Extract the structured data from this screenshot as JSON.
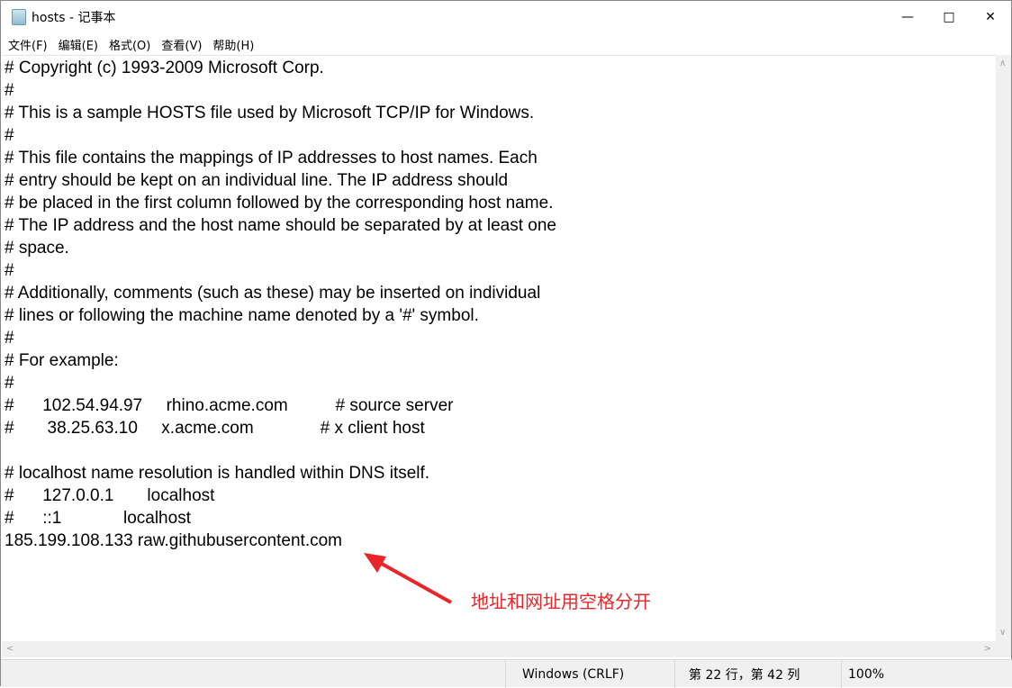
{
  "window": {
    "title": "hosts - 记事本",
    "icon": "notepad-icon",
    "controls": [
      "minimize",
      "maximize",
      "close"
    ]
  },
  "menu": [
    "文件(F)",
    "编辑(E)",
    "格式(O)",
    "查看(V)",
    "帮助(H)"
  ],
  "editor": {
    "text": "# Copyright (c) 1993-2009 Microsoft Corp.\n#\n# This is a sample HOSTS file used by Microsoft TCP/IP for Windows.\n#\n# This file contains the mappings of IP addresses to host names. Each\n# entry should be kept on an individual line. The IP address should\n# be placed in the first column followed by the corresponding host name.\n# The IP address and the host name should be separated by at least one\n# space.\n#\n# Additionally, comments (such as these) may be inserted on individual\n# lines or following the machine name denoted by a '#' symbol.\n#\n# For example:\n#\n#      102.54.94.97     rhino.acme.com          # source server\n#       38.25.63.10     x.acme.com              # x client host\n\n# localhost name resolution is handled within DNS itself.\n#\t127.0.0.1       localhost\n#\t::1             localhost\n185.199.108.133 raw.githubusercontent.com"
  },
  "annotation": {
    "text": "地址和网址用空格分开",
    "color": "#e8262a"
  },
  "status": {
    "line_ending": "Windows (CRLF)",
    "position": "第 22 行，第 42 列",
    "zoom": "100%"
  }
}
